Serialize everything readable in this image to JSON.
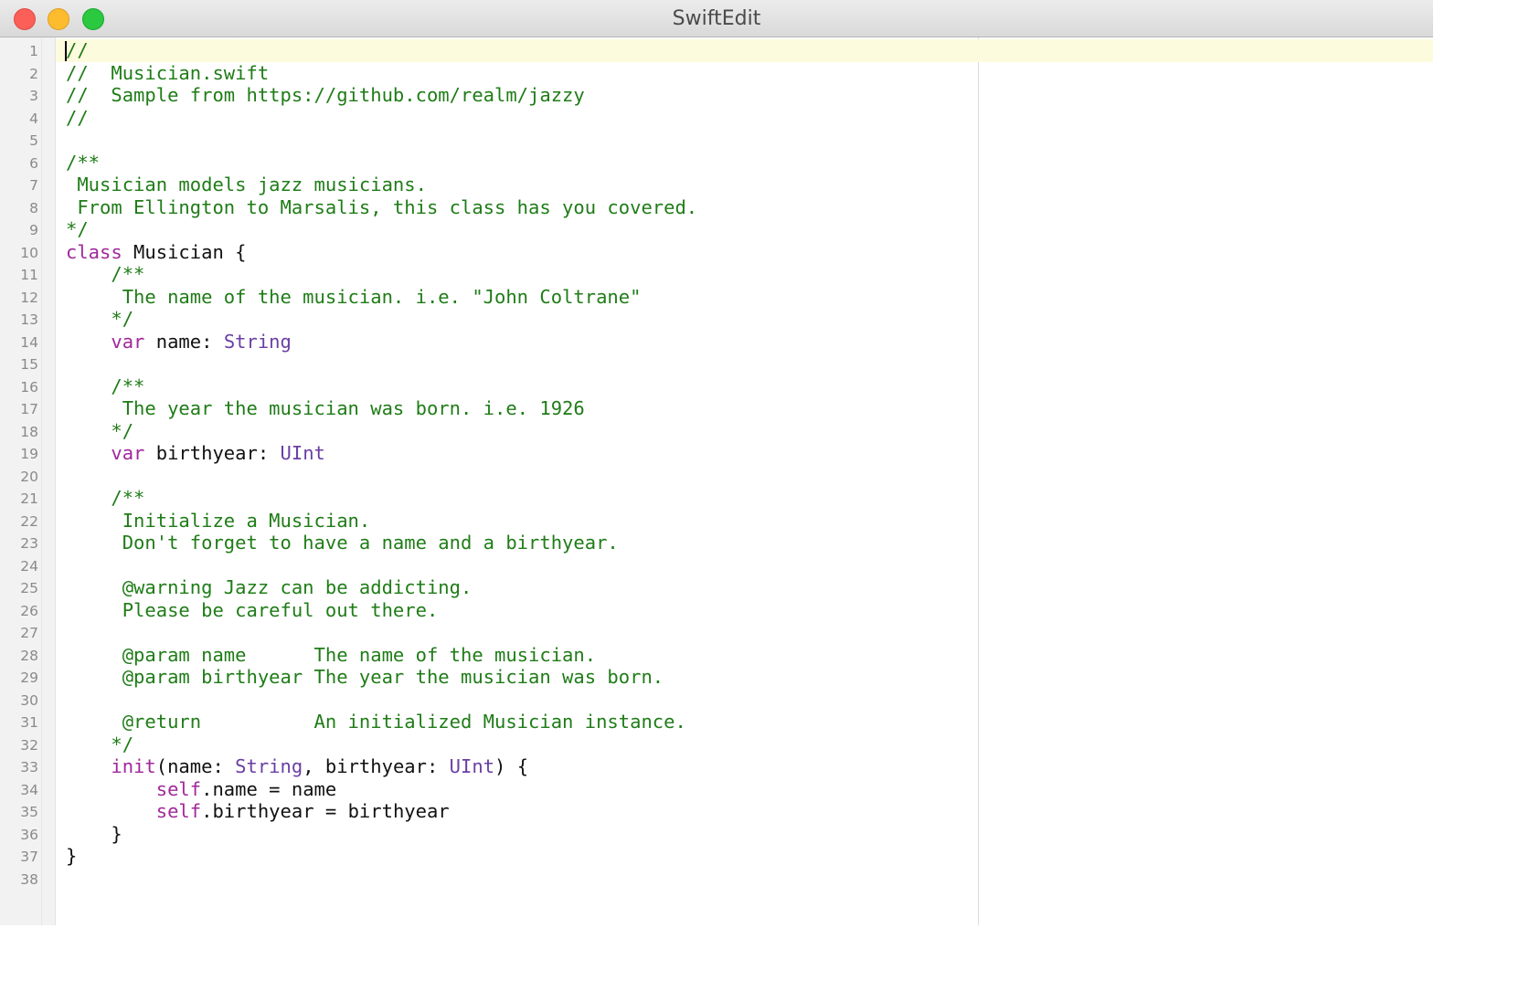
{
  "window": {
    "title": "SwiftEdit"
  },
  "colors": {
    "comment": "#1f7c17",
    "keyword": "#a1289b",
    "type": "#6a3fa3",
    "plain": "#111111",
    "current_line": "#fdfbdd"
  },
  "editor": {
    "current_line": 1,
    "lines": [
      {
        "n": "1",
        "tokens": [
          {
            "t": "//",
            "c": "comment"
          }
        ]
      },
      {
        "n": "2",
        "tokens": [
          {
            "t": "//  Musician.swift",
            "c": "comment"
          }
        ]
      },
      {
        "n": "3",
        "tokens": [
          {
            "t": "//  Sample from https://github.com/realm/jazzy",
            "c": "comment"
          }
        ]
      },
      {
        "n": "4",
        "tokens": [
          {
            "t": "//",
            "c": "comment"
          }
        ]
      },
      {
        "n": "5",
        "tokens": []
      },
      {
        "n": "6",
        "tokens": [
          {
            "t": "/**",
            "c": "comment"
          }
        ]
      },
      {
        "n": "7",
        "tokens": [
          {
            "t": " Musician models jazz musicians.",
            "c": "comment"
          }
        ]
      },
      {
        "n": "8",
        "tokens": [
          {
            "t": " From Ellington to Marsalis, this class has you covered.",
            "c": "comment"
          }
        ]
      },
      {
        "n": "9",
        "tokens": [
          {
            "t": "*/",
            "c": "comment"
          }
        ]
      },
      {
        "n": "10",
        "tokens": [
          {
            "t": "class",
            "c": "keyword"
          },
          {
            "t": " Musician {",
            "c": "plain"
          }
        ]
      },
      {
        "n": "11",
        "tokens": [
          {
            "t": "    /**",
            "c": "comment"
          }
        ]
      },
      {
        "n": "12",
        "tokens": [
          {
            "t": "     The name of the musician. i.e. \"John Coltrane\"",
            "c": "comment"
          }
        ]
      },
      {
        "n": "13",
        "tokens": [
          {
            "t": "    */",
            "c": "comment"
          }
        ]
      },
      {
        "n": "14",
        "tokens": [
          {
            "t": "    ",
            "c": "plain"
          },
          {
            "t": "var",
            "c": "keyword"
          },
          {
            "t": " name: ",
            "c": "plain"
          },
          {
            "t": "String",
            "c": "type"
          }
        ]
      },
      {
        "n": "15",
        "tokens": []
      },
      {
        "n": "16",
        "tokens": [
          {
            "t": "    /**",
            "c": "comment"
          }
        ]
      },
      {
        "n": "17",
        "tokens": [
          {
            "t": "     The year the musician was born. i.e. 1926",
            "c": "comment"
          }
        ]
      },
      {
        "n": "18",
        "tokens": [
          {
            "t": "    */",
            "c": "comment"
          }
        ]
      },
      {
        "n": "19",
        "tokens": [
          {
            "t": "    ",
            "c": "plain"
          },
          {
            "t": "var",
            "c": "keyword"
          },
          {
            "t": " birthyear: ",
            "c": "plain"
          },
          {
            "t": "UInt",
            "c": "type"
          }
        ]
      },
      {
        "n": "20",
        "tokens": []
      },
      {
        "n": "21",
        "tokens": [
          {
            "t": "    /**",
            "c": "comment"
          }
        ]
      },
      {
        "n": "22",
        "tokens": [
          {
            "t": "     Initialize a Musician.",
            "c": "comment"
          }
        ]
      },
      {
        "n": "23",
        "tokens": [
          {
            "t": "     Don't forget to have a name and a birthyear.",
            "c": "comment"
          }
        ]
      },
      {
        "n": "24",
        "tokens": []
      },
      {
        "n": "25",
        "tokens": [
          {
            "t": "     @warning Jazz can be addicting.",
            "c": "comment"
          }
        ]
      },
      {
        "n": "26",
        "tokens": [
          {
            "t": "     Please be careful out there.",
            "c": "comment"
          }
        ]
      },
      {
        "n": "27",
        "tokens": []
      },
      {
        "n": "28",
        "tokens": [
          {
            "t": "     @param name      The name of the musician.",
            "c": "comment"
          }
        ]
      },
      {
        "n": "29",
        "tokens": [
          {
            "t": "     @param birthyear The year the musician was born.",
            "c": "comment"
          }
        ]
      },
      {
        "n": "30",
        "tokens": []
      },
      {
        "n": "31",
        "tokens": [
          {
            "t": "     @return          An initialized Musician instance.",
            "c": "comment"
          }
        ]
      },
      {
        "n": "32",
        "tokens": [
          {
            "t": "    */",
            "c": "comment"
          }
        ]
      },
      {
        "n": "33",
        "tokens": [
          {
            "t": "    ",
            "c": "plain"
          },
          {
            "t": "init",
            "c": "keyword"
          },
          {
            "t": "(name: ",
            "c": "plain"
          },
          {
            "t": "String",
            "c": "type"
          },
          {
            "t": ", birthyear: ",
            "c": "plain"
          },
          {
            "t": "UInt",
            "c": "type"
          },
          {
            "t": ") {",
            "c": "plain"
          }
        ]
      },
      {
        "n": "34",
        "tokens": [
          {
            "t": "        ",
            "c": "plain"
          },
          {
            "t": "self",
            "c": "keyword"
          },
          {
            "t": ".name = name",
            "c": "plain"
          }
        ]
      },
      {
        "n": "35",
        "tokens": [
          {
            "t": "        ",
            "c": "plain"
          },
          {
            "t": "self",
            "c": "keyword"
          },
          {
            "t": ".birthyear = birthyear",
            "c": "plain"
          }
        ]
      },
      {
        "n": "36",
        "tokens": [
          {
            "t": "    }",
            "c": "plain"
          }
        ]
      },
      {
        "n": "37",
        "tokens": [
          {
            "t": "}",
            "c": "plain"
          }
        ]
      },
      {
        "n": "38",
        "tokens": []
      }
    ]
  }
}
